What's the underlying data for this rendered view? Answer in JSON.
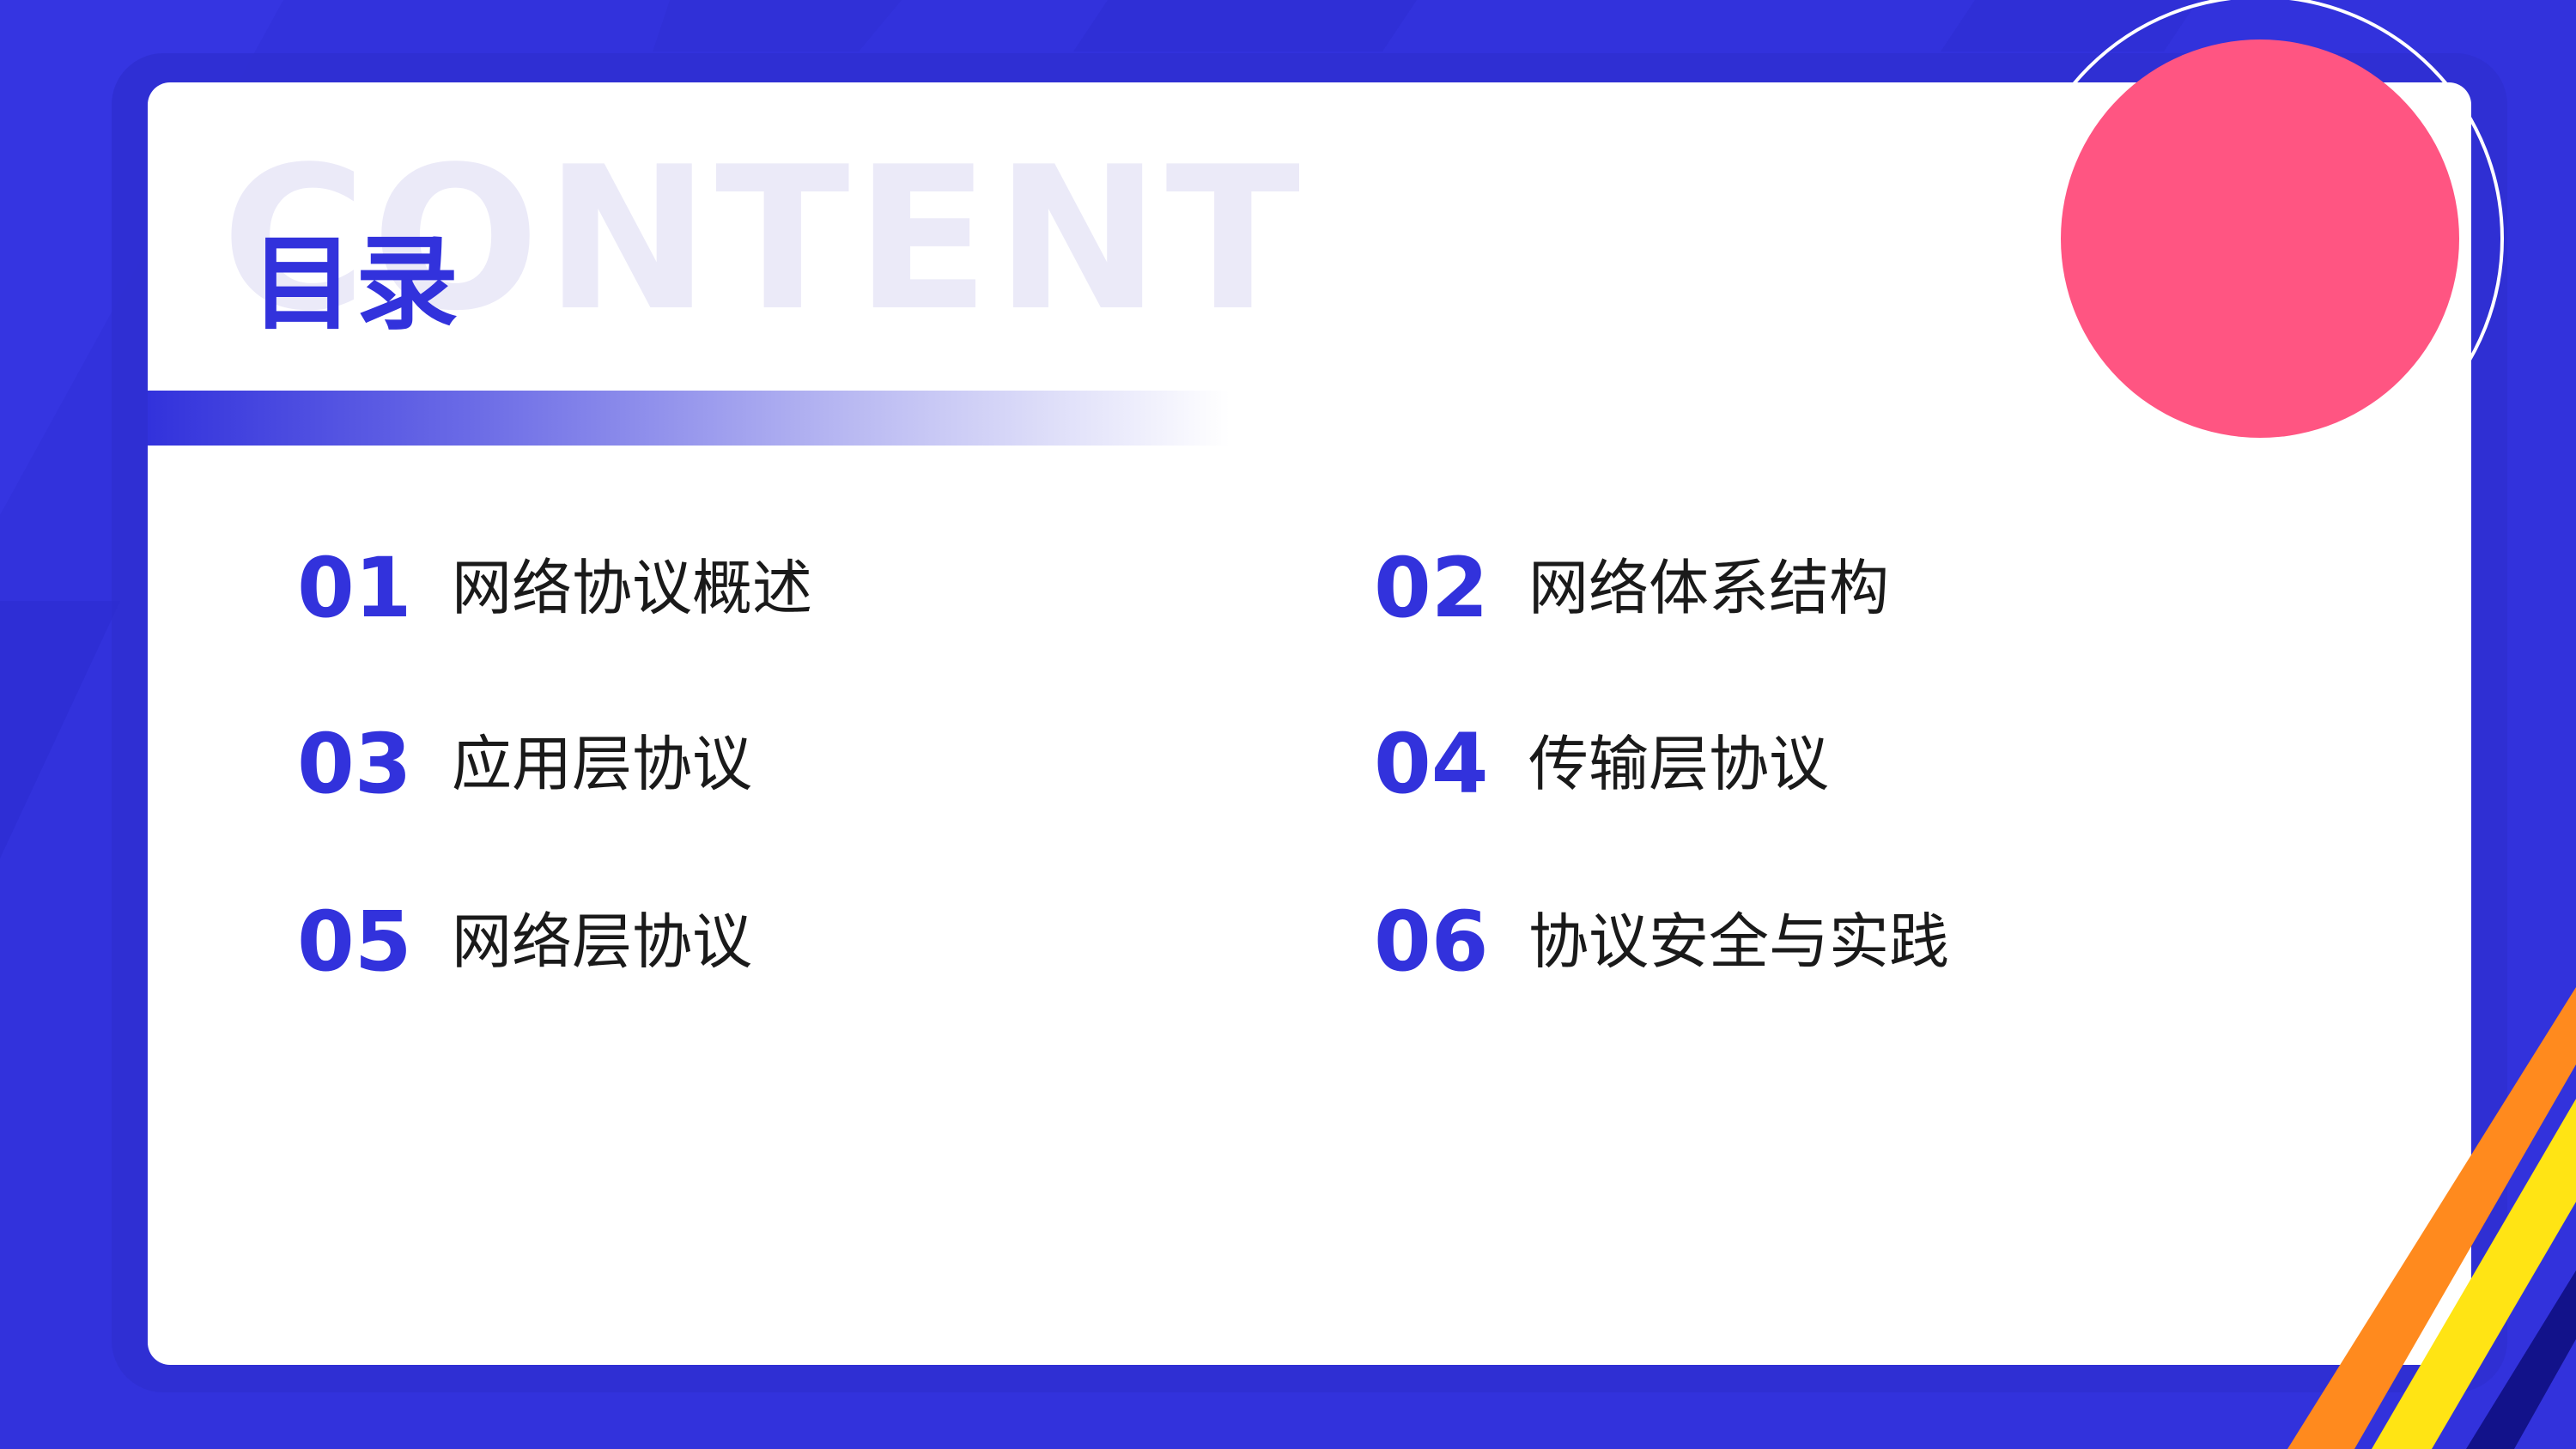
{
  "colors": {
    "background": "#3232dc",
    "card": "#ffffff",
    "accent_blue": "#3232dc",
    "circle_pink": "#ff5582",
    "stripe_orange": "#ff8a1e",
    "stripe_yellow": "#ffe414",
    "stripe_navy": "#12128a",
    "watermark": "#ebeaf8"
  },
  "header": {
    "watermark": "CONTENT",
    "title": "目录"
  },
  "toc": {
    "items": [
      {
        "number": "01",
        "label": "网络协议概述"
      },
      {
        "number": "02",
        "label": "网络体系结构"
      },
      {
        "number": "03",
        "label": "应用层协议"
      },
      {
        "number": "04",
        "label": "传输层协议"
      },
      {
        "number": "05",
        "label": "网络层协议"
      },
      {
        "number": "06",
        "label": "协议安全与实践"
      }
    ]
  }
}
